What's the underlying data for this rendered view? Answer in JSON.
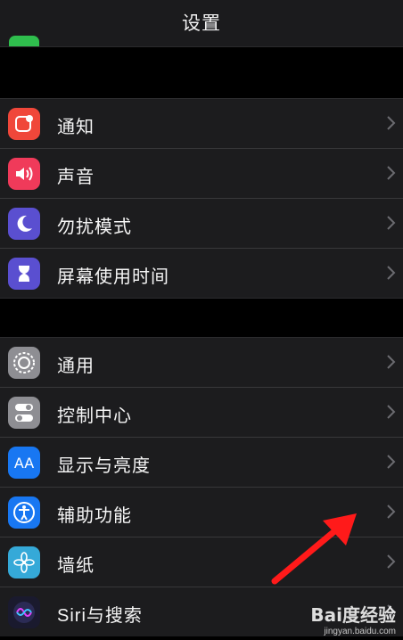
{
  "navbar": {
    "title": "设置"
  },
  "group1": [
    {
      "label": "通知",
      "icon": "notifications-icon",
      "color": "#f0473a"
    },
    {
      "label": "声音",
      "icon": "sound-icon",
      "color": "#f03a5a"
    },
    {
      "label": "勿扰模式",
      "icon": "moon-icon",
      "color": "#5a4fd0"
    },
    {
      "label": "屏幕使用时间",
      "icon": "hourglass-icon",
      "color": "#5a4fd0"
    }
  ],
  "group2": [
    {
      "label": "通用",
      "icon": "gear-icon",
      "color": "#8e8e93"
    },
    {
      "label": "控制中心",
      "icon": "toggles-icon",
      "color": "#8e8e93"
    },
    {
      "label": "显示与亮度",
      "icon": "display-aa-icon",
      "color": "#1877f2"
    },
    {
      "label": "辅助功能",
      "icon": "accessibility-icon",
      "color": "#1877f2"
    },
    {
      "label": "墙纸",
      "icon": "wallpaper-flower-icon",
      "color": "#35a9d8"
    },
    {
      "label": "Siri与搜索",
      "icon": "siri-icon",
      "color": "#1a1a2e"
    }
  ],
  "watermark": {
    "brand": "Bai度经验",
    "url": "jingyan.baidu.com"
  }
}
